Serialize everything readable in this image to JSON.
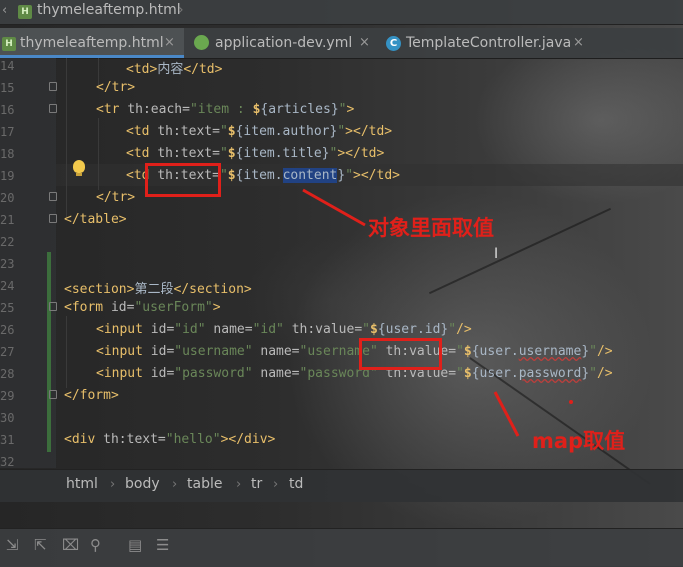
{
  "nav_breadcrumb": {
    "file": "thymeleaftemp.html",
    "file_icon_letter": "H"
  },
  "tabs": [
    {
      "label": "thymeleaftemp.html",
      "icon": "H",
      "active": true
    },
    {
      "label": "application-dev.yml",
      "icon": "leaf-icon",
      "active": false
    },
    {
      "label": "TemplateController.java",
      "icon": "C",
      "active": false
    }
  ],
  "tab_close": "×",
  "line_numbers": [
    "14",
    "15",
    "16",
    "17",
    "18",
    "19",
    "20",
    "21",
    "22",
    "23",
    "24",
    "25",
    "26",
    "27",
    "28",
    "29",
    "30",
    "31",
    "32"
  ],
  "code": {
    "l14": {
      "open": "<td>",
      "text": "内容",
      "close": "</td>"
    },
    "l15": {
      "close": "</tr>"
    },
    "l16": {
      "open": "<tr ",
      "attr": "th:each=",
      "val1": "\"item : ",
      "dollar": "$",
      "expr": "{articles}",
      "val2": "\"",
      "end": ">"
    },
    "l17": {
      "open": "<td ",
      "attr": "th:text=",
      "q": "\"",
      "dollar": "$",
      "expr": "{item.author}",
      "q2": "\"",
      "close": "></td>"
    },
    "l18": {
      "open": "<td ",
      "attr": "th:text=",
      "q": "\"",
      "dollar": "$",
      "expr": "{item.title}",
      "q2": "\"",
      "close": "></td>"
    },
    "l19": {
      "open": "<td ",
      "attr": "th:text=",
      "q": "\"",
      "dollar": "$",
      "expr_a": "{item.",
      "expr_hl": "content",
      "expr_b": "}",
      "q2": "\"",
      "close": "></td>"
    },
    "l20": {
      "close": "</tr>"
    },
    "l21": {
      "close": "</table>"
    },
    "l24": {
      "open": "<section>",
      "text": "第二段",
      "close": "</section>"
    },
    "l25": {
      "open": "<form ",
      "attr": "id=",
      "val": "\"userForm\"",
      "end": ">"
    },
    "l26": {
      "open": "<input ",
      "a1": "id=",
      "v1": "\"id\" ",
      "a2": "name=",
      "v2": "\"id\" ",
      "a3": "th:value=",
      "q": "\"",
      "dollar": "$",
      "expr": "{user.id}",
      "q2": "\"",
      "end": "/>"
    },
    "l27": {
      "open": "<input ",
      "a1": "id=",
      "v1": "\"username\" ",
      "a2": "name=",
      "v2": "\"username\" ",
      "a3": "th:value=",
      "q": "\"",
      "dollar": "$",
      "expr_a": "{user.",
      "expr_sq": "username",
      "expr_b": "}",
      "q2": "\"",
      "end": "/>"
    },
    "l28": {
      "open": "<input ",
      "a1": "id=",
      "v1": "\"password\" ",
      "a2": "name=",
      "v2": "\"password\" ",
      "a3": "th:value=",
      "q": "\"",
      "dollar": "$",
      "expr_a": "{user.",
      "expr_sq": "password",
      "expr_b": "}",
      "q2": "\"",
      "end": "/>"
    },
    "l29": {
      "close": "</form>"
    },
    "l31": {
      "open": "<div ",
      "attr": "th:text=",
      "val": "\"hello\"",
      "close": "></div>"
    }
  },
  "annotations": {
    "object_value": "对象里面取值",
    "map_value": "map取值"
  },
  "bottom_breadcrumb": [
    "html",
    "body",
    "table",
    "tr",
    "td"
  ],
  "toolbar_icons": [
    "soft-wrap-icon",
    "scroll-to-end-icon",
    "clear-icon",
    "filter-icon",
    "print-icon",
    "settings-list-icon"
  ],
  "colors": {
    "tag": "#e8bf6a",
    "string": "#6a8759",
    "text": "#a9b7c6",
    "annotation": "#e0201a",
    "selection": "#214283"
  }
}
